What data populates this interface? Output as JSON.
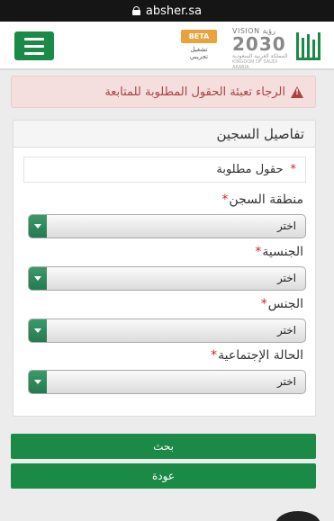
{
  "browser": {
    "url": "absher.sa"
  },
  "header": {
    "beta_badge": "BETA",
    "beta_sub": "تشغيل تجريبي",
    "vision_top": "VISION رؤية",
    "vision_year": "2030",
    "vision_line1": "المملكة العربية السعودية",
    "vision_line2": "KINGDOM OF SAUDI ARABIA"
  },
  "alert": {
    "message": "الرجاء تعبئة الحقول المطلوبة للمتابعة"
  },
  "panel": {
    "title": "تفاصيل السجين",
    "required_note": "حقول مطلوبة",
    "required_star": "*",
    "fields": [
      {
        "label": "منطقة السجن",
        "star": "*",
        "value": "اختر"
      },
      {
        "label": "الجنسية",
        "star": "*",
        "value": "اختر"
      },
      {
        "label": "الجنس",
        "star": "*",
        "value": "اختر"
      },
      {
        "label": "الحالة الإجتماعية",
        "star": "*",
        "value": "اختر"
      }
    ]
  },
  "buttons": {
    "search": "بحث",
    "back": "عودة"
  },
  "colors": {
    "brand_green": "#1b8a47",
    "alert_text": "#a94442",
    "alert_bg": "#f5dede"
  }
}
